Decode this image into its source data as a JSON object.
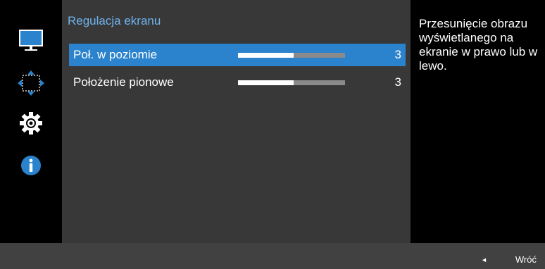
{
  "sidebar": {
    "icons": [
      {
        "name": "picture-icon"
      },
      {
        "name": "position-arrows-icon"
      },
      {
        "name": "gear-icon"
      },
      {
        "name": "info-icon"
      }
    ]
  },
  "menu": {
    "title": "Regulacja ekranu",
    "items": [
      {
        "label": "Poł. w poziomie",
        "value": "3",
        "level": 0.52,
        "selected": true
      },
      {
        "label": "Położenie pionowe",
        "value": "3",
        "level": 0.52,
        "selected": false
      }
    ]
  },
  "help": {
    "text": "Przesunięcie obrazu wyświetlanego na ekranie w prawo lub w lewo."
  },
  "footer": {
    "back_label": "Wróć"
  },
  "colors": {
    "accent": "#2a83cc",
    "title": "#6fb4ee",
    "panel": "#383838",
    "background": "#414141"
  }
}
